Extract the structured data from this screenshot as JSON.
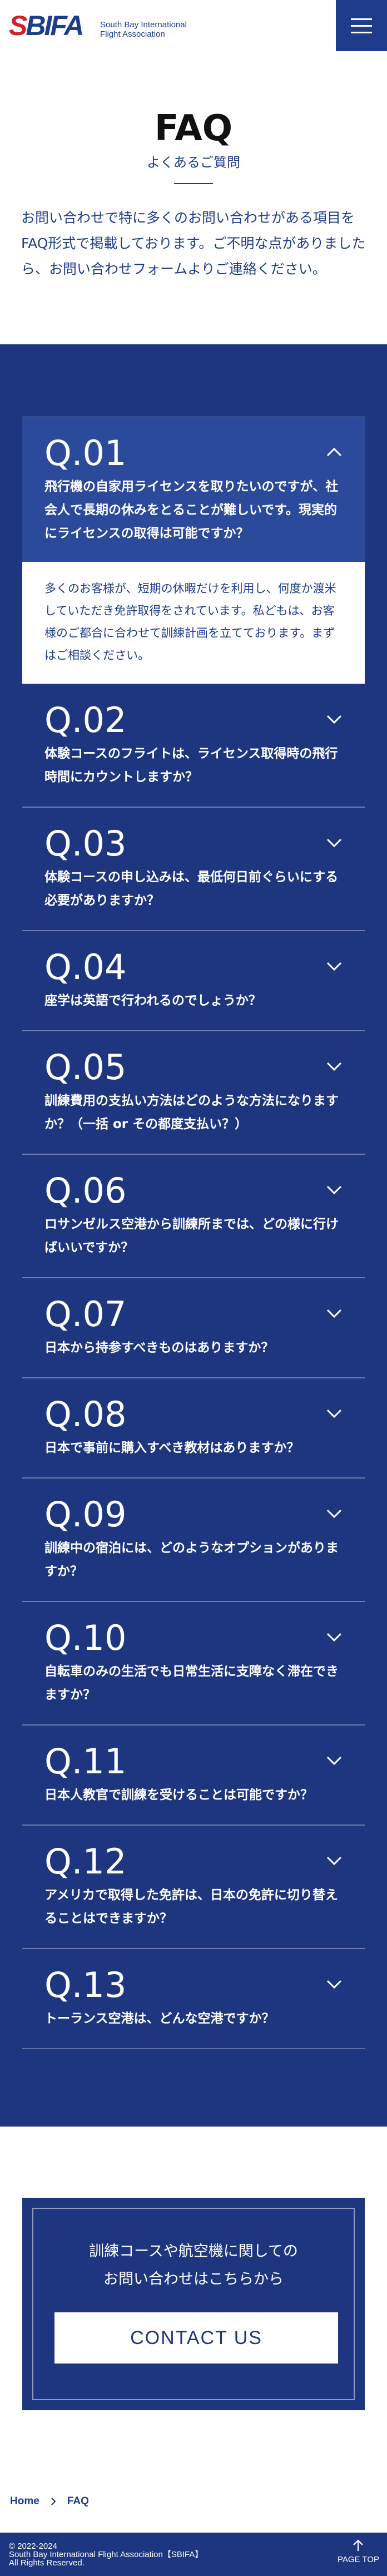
{
  "header": {
    "logo_mark_s": "S",
    "logo_mark_rest": "BIFA",
    "logo_line1": "South Bay International",
    "logo_line2": "Flight Association"
  },
  "page": {
    "title": "FAQ",
    "subtitle": "よくあるご質問",
    "intro": "お問い合わせで特に多くのお問い合わせがある項目をFAQ形式で掲載しております。ご不明な点がありましたら、お問い合わせフォームよりご連絡ください。"
  },
  "faq": [
    {
      "num": "Q.01",
      "question": "飛行機の自家用ライセンスを取りたいのですが、社会人で長期の休みをとることが難しいです。現実的にライセンスの取得は可能ですか？",
      "answer": "多くのお客様が、短期の休暇だけを利用し、何度か渡米していただき免許取得をされています。私どもは、お客様のご都合に合わせて訓練計画を立てております。まずはご相談ください。",
      "open": true
    },
    {
      "num": "Q.02",
      "question": "体験コースのフライトは、ライセンス取得時の飛行時間にカウントしますか？"
    },
    {
      "num": "Q.03",
      "question": "体験コースの申し込みは、最低何日前ぐらいにする必要がありますか？"
    },
    {
      "num": "Q.04",
      "question": "座学は英語で行われるのでしょうか？"
    },
    {
      "num": "Q.05",
      "question": "訓練費用の支払い方法はどのような方法になりますか？（一括 or その都度支払い？）"
    },
    {
      "num": "Q.06",
      "question": "ロサンゼルス空港から訓練所までは、どの様に行けばいいですか？"
    },
    {
      "num": "Q.07",
      "question": "日本から持参すべきものはありますか？"
    },
    {
      "num": "Q.08",
      "question": "日本で事前に購入すべき教材はありますか？"
    },
    {
      "num": "Q.09",
      "question": "訓練中の宿泊には、どのようなオプションがありますか？"
    },
    {
      "num": "Q.10",
      "question": "自転車のみの生活でも日常生活に支障なく滞在できますか？"
    },
    {
      "num": "Q.11",
      "question": "日本人教官で訓練を受けることは可能ですか？"
    },
    {
      "num": "Q.12",
      "question": "アメリカで取得した免許は、日本の免許に切り替えることはできますか？"
    },
    {
      "num": "Q.13",
      "question": "トーランス空港は、どんな空港ですか？"
    }
  ],
  "contact": {
    "lead_line1": "訓練コースや航空機に関しての",
    "lead_line2": "お問い合わせはこちらから",
    "button": "CONTACT US"
  },
  "breadcrumb": {
    "home": "Home",
    "current": "FAQ"
  },
  "footer": {
    "copy_line1": "© 2022-2024",
    "copy_line2": "South Bay International Flight Association【SBIFA】",
    "copy_line3": "All Rights Reserved.",
    "pagetop": "PAGE TOP"
  },
  "colors": {
    "brand_navy": "#1e3680",
    "brand_red": "#d3202b",
    "open_item": "#2c4a9b"
  },
  "icons": {
    "menu": "hamburger-icon",
    "toggle_open": "chevron-up-icon",
    "toggle_closed": "chevron-down-icon",
    "breadcrumb_sep": "chevron-right-icon",
    "pagetop": "arrow-up-icon"
  }
}
